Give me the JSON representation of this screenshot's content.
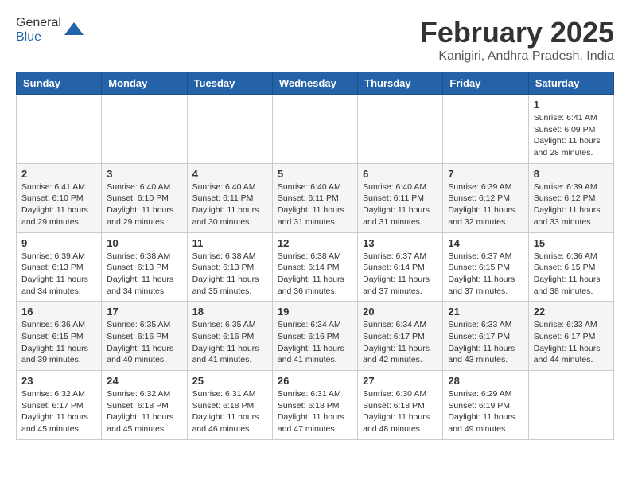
{
  "header": {
    "logo_general": "General",
    "logo_blue": "Blue",
    "month_title": "February 2025",
    "location": "Kanigiri, Andhra Pradesh, India"
  },
  "weekdays": [
    "Sunday",
    "Monday",
    "Tuesday",
    "Wednesday",
    "Thursday",
    "Friday",
    "Saturday"
  ],
  "weeks": [
    [
      {
        "day": "",
        "info": ""
      },
      {
        "day": "",
        "info": ""
      },
      {
        "day": "",
        "info": ""
      },
      {
        "day": "",
        "info": ""
      },
      {
        "day": "",
        "info": ""
      },
      {
        "day": "",
        "info": ""
      },
      {
        "day": "1",
        "info": "Sunrise: 6:41 AM\nSunset: 6:09 PM\nDaylight: 11 hours and 28 minutes."
      }
    ],
    [
      {
        "day": "2",
        "info": "Sunrise: 6:41 AM\nSunset: 6:10 PM\nDaylight: 11 hours and 29 minutes."
      },
      {
        "day": "3",
        "info": "Sunrise: 6:40 AM\nSunset: 6:10 PM\nDaylight: 11 hours and 29 minutes."
      },
      {
        "day": "4",
        "info": "Sunrise: 6:40 AM\nSunset: 6:11 PM\nDaylight: 11 hours and 30 minutes."
      },
      {
        "day": "5",
        "info": "Sunrise: 6:40 AM\nSunset: 6:11 PM\nDaylight: 11 hours and 31 minutes."
      },
      {
        "day": "6",
        "info": "Sunrise: 6:40 AM\nSunset: 6:11 PM\nDaylight: 11 hours and 31 minutes."
      },
      {
        "day": "7",
        "info": "Sunrise: 6:39 AM\nSunset: 6:12 PM\nDaylight: 11 hours and 32 minutes."
      },
      {
        "day": "8",
        "info": "Sunrise: 6:39 AM\nSunset: 6:12 PM\nDaylight: 11 hours and 33 minutes."
      }
    ],
    [
      {
        "day": "9",
        "info": "Sunrise: 6:39 AM\nSunset: 6:13 PM\nDaylight: 11 hours and 34 minutes."
      },
      {
        "day": "10",
        "info": "Sunrise: 6:38 AM\nSunset: 6:13 PM\nDaylight: 11 hours and 34 minutes."
      },
      {
        "day": "11",
        "info": "Sunrise: 6:38 AM\nSunset: 6:13 PM\nDaylight: 11 hours and 35 minutes."
      },
      {
        "day": "12",
        "info": "Sunrise: 6:38 AM\nSunset: 6:14 PM\nDaylight: 11 hours and 36 minutes."
      },
      {
        "day": "13",
        "info": "Sunrise: 6:37 AM\nSunset: 6:14 PM\nDaylight: 11 hours and 37 minutes."
      },
      {
        "day": "14",
        "info": "Sunrise: 6:37 AM\nSunset: 6:15 PM\nDaylight: 11 hours and 37 minutes."
      },
      {
        "day": "15",
        "info": "Sunrise: 6:36 AM\nSunset: 6:15 PM\nDaylight: 11 hours and 38 minutes."
      }
    ],
    [
      {
        "day": "16",
        "info": "Sunrise: 6:36 AM\nSunset: 6:15 PM\nDaylight: 11 hours and 39 minutes."
      },
      {
        "day": "17",
        "info": "Sunrise: 6:35 AM\nSunset: 6:16 PM\nDaylight: 11 hours and 40 minutes."
      },
      {
        "day": "18",
        "info": "Sunrise: 6:35 AM\nSunset: 6:16 PM\nDaylight: 11 hours and 41 minutes."
      },
      {
        "day": "19",
        "info": "Sunrise: 6:34 AM\nSunset: 6:16 PM\nDaylight: 11 hours and 41 minutes."
      },
      {
        "day": "20",
        "info": "Sunrise: 6:34 AM\nSunset: 6:17 PM\nDaylight: 11 hours and 42 minutes."
      },
      {
        "day": "21",
        "info": "Sunrise: 6:33 AM\nSunset: 6:17 PM\nDaylight: 11 hours and 43 minutes."
      },
      {
        "day": "22",
        "info": "Sunrise: 6:33 AM\nSunset: 6:17 PM\nDaylight: 11 hours and 44 minutes."
      }
    ],
    [
      {
        "day": "23",
        "info": "Sunrise: 6:32 AM\nSunset: 6:17 PM\nDaylight: 11 hours and 45 minutes."
      },
      {
        "day": "24",
        "info": "Sunrise: 6:32 AM\nSunset: 6:18 PM\nDaylight: 11 hours and 45 minutes."
      },
      {
        "day": "25",
        "info": "Sunrise: 6:31 AM\nSunset: 6:18 PM\nDaylight: 11 hours and 46 minutes."
      },
      {
        "day": "26",
        "info": "Sunrise: 6:31 AM\nSunset: 6:18 PM\nDaylight: 11 hours and 47 minutes."
      },
      {
        "day": "27",
        "info": "Sunrise: 6:30 AM\nSunset: 6:18 PM\nDaylight: 11 hours and 48 minutes."
      },
      {
        "day": "28",
        "info": "Sunrise: 6:29 AM\nSunset: 6:19 PM\nDaylight: 11 hours and 49 minutes."
      },
      {
        "day": "",
        "info": ""
      }
    ]
  ]
}
